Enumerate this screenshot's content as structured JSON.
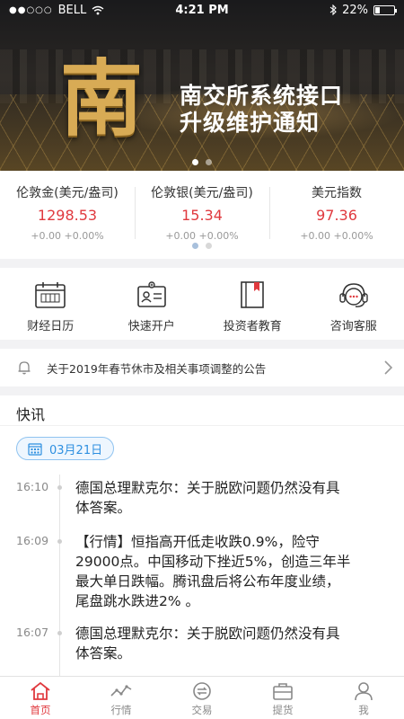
{
  "status": {
    "carrier": "BELL",
    "time": "4:21 PM",
    "battery": "22%"
  },
  "banner": {
    "logo_char": "南",
    "title_line1": "南交所系统接口",
    "title_line2": "升级维护通知"
  },
  "quotes": [
    {
      "name": "伦敦金(美元/盎司)",
      "price": "1298.53",
      "change": "+0.00 +0.00%"
    },
    {
      "name": "伦敦银(美元/盎司)",
      "price": "15.34",
      "change": "+0.00 +0.00%"
    },
    {
      "name": "美元指数",
      "price": "97.36",
      "change": "+0.00 +0.00%"
    }
  ],
  "menu": [
    {
      "label": "财经日历",
      "icon": "calendar-icon"
    },
    {
      "label": "快速开户",
      "icon": "id-card-icon"
    },
    {
      "label": "投资者教育",
      "icon": "book-icon"
    },
    {
      "label": "咨询客服",
      "icon": "customer-service-icon"
    }
  ],
  "notice": {
    "text": "关于2019年春节休市及相关事项调整的公告"
  },
  "news": {
    "header": "快讯",
    "date": "03月21日",
    "items": [
      {
        "time": "16:10",
        "line1": "德国总理默克尔：关于脱欧问题仍然没有具",
        "line2": "体答案。"
      },
      {
        "time": "16:09",
        "line1": "【行情】恒指高开低走收跌0.9%，险守",
        "line2": "29000点。中国移动下挫近5%，创造三年半",
        "line3": "最大单日跌幅。腾讯盘后将公布年度业绩，",
        "line4": "尾盘跳水跌进2% 。"
      },
      {
        "time": "16:07",
        "line1": "德国总理默克尔：关于脱欧问题仍然没有具",
        "line2": "体答案。"
      }
    ]
  },
  "tabs": [
    {
      "label": "首页",
      "icon": "home-icon",
      "active": true
    },
    {
      "label": "行情",
      "icon": "market-chart-icon"
    },
    {
      "label": "交易",
      "icon": "trade-icon"
    },
    {
      "label": "提货",
      "icon": "briefcase-icon"
    },
    {
      "label": "我",
      "icon": "user-icon"
    }
  ],
  "colors": {
    "accent_red": "#e0393e",
    "pill_blue": "#2d8fe0",
    "banner_gold": "#d8ab55"
  }
}
